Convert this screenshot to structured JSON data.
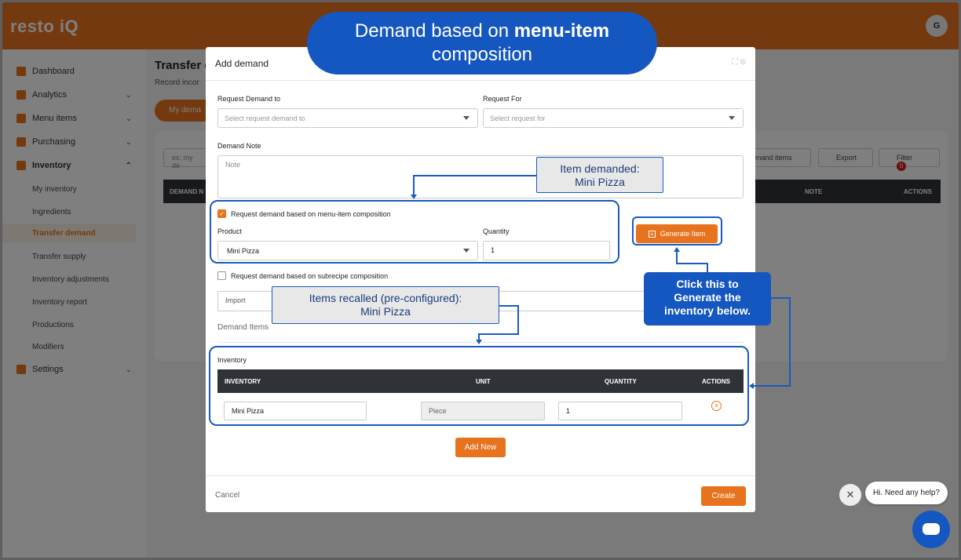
{
  "app": {
    "logo": "resto iQ",
    "avatar_initial": "G"
  },
  "sidebar": {
    "items": [
      {
        "label": "Dashboard"
      },
      {
        "label": "Analytics"
      },
      {
        "label": "Menu items"
      },
      {
        "label": "Purchasing"
      },
      {
        "label": "Inventory"
      },
      {
        "label": "Settings"
      }
    ],
    "inventory_sub": [
      "My inventory",
      "Ingredients",
      "Transfer demand",
      "Transfer supply",
      "Inventory adjustments",
      "Inventory report",
      "Productions",
      "Modifiers"
    ]
  },
  "page": {
    "title": "Transfer d",
    "subtitle": "Record incor",
    "tab": "My dema",
    "search_placeholder": "ex: my de",
    "demand_items_btn": "mand items",
    "export_btn": "Export",
    "filter_btn": "Filter",
    "filter_count": "0",
    "table_headers": {
      "col1": "DEMAND N",
      "note": "NOTE",
      "actions": "ACTIONS"
    }
  },
  "modal": {
    "title": "Add demand",
    "request_demand_to_label": "Request Demand to",
    "request_demand_to_placeholder": "Select request demand to",
    "request_for_label": "Request For",
    "request_for_placeholder": "Select request for",
    "demand_note_label": "Demand Note",
    "note_placeholder": "Note",
    "menu_item_check_label": "Request demand based on menu-item composition",
    "product_label": "Product",
    "product_value": "Mini Pizza",
    "quantity_label": "Quantity",
    "quantity_value": "1",
    "generate_btn": "Generate Item",
    "subrecipe_check_label": "Request demand based on subrecipe composition",
    "import_label": "Import",
    "demand_items_label": "Demand Items",
    "inventory_label": "Inventory",
    "table_headers": {
      "inventory": "INVENTORY",
      "unit": "UNIT",
      "quantity": "QUANTITY",
      "actions": "ACTIONS"
    },
    "row": {
      "inventory": "Mini Pizza",
      "unit": "Piece",
      "quantity": "1"
    },
    "add_new_btn": "Add New",
    "cancel_btn": "Cancel",
    "create_btn": "Create"
  },
  "annotations": {
    "title_line1_a": "Demand based on ",
    "title_line1_b": "menu-item",
    "title_line2": "composition",
    "item_demanded_1": "Item demanded:",
    "item_demanded_2": "Mini Pizza",
    "items_recalled_1": "Items recalled (pre-configured):",
    "items_recalled_2": "Mini Pizza",
    "click_1": "Click this to",
    "click_2": "Generate the",
    "click_3": "inventory below."
  },
  "chat": {
    "greeting": "Hi. Need any help?"
  },
  "colors": {
    "accent": "#e8731e",
    "annotation_blue": "#1557c0"
  }
}
